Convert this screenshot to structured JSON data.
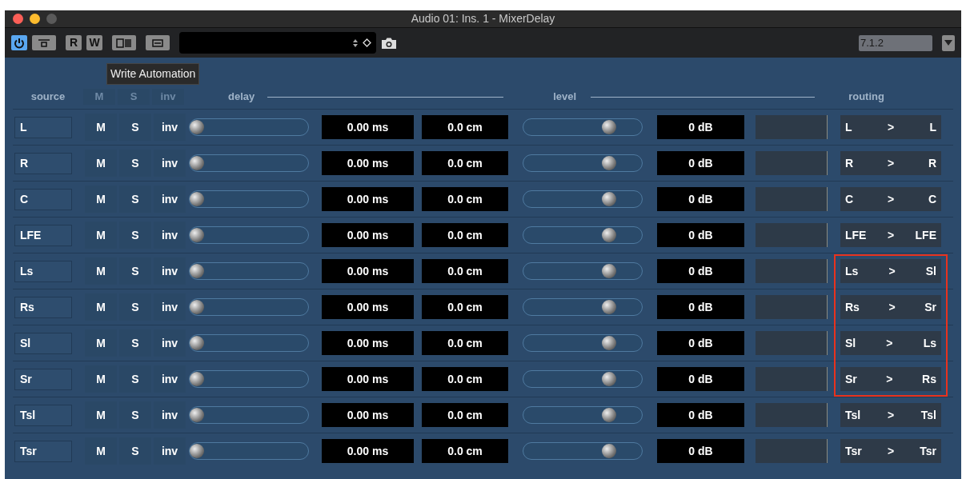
{
  "window": {
    "title": "Audio 01: Ins. 1 - MixerDelay"
  },
  "toolbar": {
    "buttons": [
      {
        "kind": "power",
        "on": true
      },
      {
        "kind": "bypass",
        "on": false
      },
      {
        "kind": "read",
        "label": "R",
        "on": false
      },
      {
        "kind": "write",
        "label": "W",
        "on": false
      },
      {
        "kind": "ab",
        "on": false
      },
      {
        "kind": "panel",
        "on": false
      }
    ],
    "tooltip": "Write Automation",
    "format": "7.1.2"
  },
  "header": {
    "source": "source",
    "mute": "M",
    "solo": "S",
    "invert": "inv",
    "delay": "delay",
    "level": "level",
    "routing": "routing"
  },
  "channels": [
    {
      "source": "L",
      "mute": "M",
      "solo": "S",
      "invert": "inv",
      "delay_slider": {
        "level": 0
      },
      "delay_ms": "0.00 ms",
      "delay_cm": "0.0 cm",
      "gain_slider": {
        "level": 0.75
      },
      "gain": "0 dB",
      "route_in": "L",
      "arrow": ">",
      "route_out": "L",
      "highlighted": false
    },
    {
      "source": "R",
      "mute": "M",
      "solo": "S",
      "invert": "inv",
      "delay_slider": {
        "level": 0
      },
      "delay_ms": "0.00 ms",
      "delay_cm": "0.0 cm",
      "gain_slider": {
        "level": 0.75
      },
      "gain": "0 dB",
      "route_in": "R",
      "arrow": ">",
      "route_out": "R",
      "highlighted": false
    },
    {
      "source": "C",
      "mute": "M",
      "solo": "S",
      "invert": "inv",
      "delay_slider": {
        "level": 0
      },
      "delay_ms": "0.00 ms",
      "delay_cm": "0.0 cm",
      "gain_slider": {
        "level": 0.75
      },
      "gain": "0 dB",
      "route_in": "C",
      "arrow": ">",
      "route_out": "C",
      "highlighted": false
    },
    {
      "source": "LFE",
      "mute": "M",
      "solo": "S",
      "invert": "inv",
      "delay_slider": {
        "level": 0
      },
      "delay_ms": "0.00 ms",
      "delay_cm": "0.0 cm",
      "gain_slider": {
        "level": 0.75
      },
      "gain": "0 dB",
      "route_in": "LFE",
      "arrow": ">",
      "route_out": "LFE",
      "highlighted": false
    },
    {
      "source": "Ls",
      "mute": "M",
      "solo": "S",
      "invert": "inv",
      "delay_slider": {
        "level": 0
      },
      "delay_ms": "0.00 ms",
      "delay_cm": "0.0 cm",
      "gain_slider": {
        "level": 0.75
      },
      "gain": "0 dB",
      "route_in": "Ls",
      "arrow": ">",
      "route_out": "Sl",
      "highlighted": true
    },
    {
      "source": "Rs",
      "mute": "M",
      "solo": "S",
      "invert": "inv",
      "delay_slider": {
        "level": 0
      },
      "delay_ms": "0.00 ms",
      "delay_cm": "0.0 cm",
      "gain_slider": {
        "level": 0.75
      },
      "gain": "0 dB",
      "route_in": "Rs",
      "arrow": ">",
      "route_out": "Sr",
      "highlighted": true
    },
    {
      "source": "Sl",
      "mute": "M",
      "solo": "S",
      "invert": "inv",
      "delay_slider": {
        "level": 0
      },
      "delay_ms": "0.00 ms",
      "delay_cm": "0.0 cm",
      "gain_slider": {
        "level": 0.75
      },
      "gain": "0 dB",
      "route_in": "Sl",
      "arrow": ">",
      "route_out": "Ls",
      "highlighted": true
    },
    {
      "source": "Sr",
      "mute": "M",
      "solo": "S",
      "invert": "inv",
      "delay_slider": {
        "level": 0
      },
      "delay_ms": "0.00 ms",
      "delay_cm": "0.0 cm",
      "gain_slider": {
        "level": 0.75
      },
      "gain": "0 dB",
      "route_in": "Sr",
      "arrow": ">",
      "route_out": "Rs",
      "highlighted": true
    },
    {
      "source": "Tsl",
      "mute": "M",
      "solo": "S",
      "invert": "inv",
      "delay_slider": {
        "level": 0
      },
      "delay_ms": "0.00 ms",
      "delay_cm": "0.0 cm",
      "gain_slider": {
        "level": 0.75
      },
      "gain": "0 dB",
      "route_in": "Tsl",
      "arrow": ">",
      "route_out": "Tsl",
      "highlighted": false
    },
    {
      "source": "Tsr",
      "mute": "M",
      "solo": "S",
      "invert": "inv",
      "delay_slider": {
        "level": 0
      },
      "delay_ms": "0.00 ms",
      "delay_cm": "0.0 cm",
      "gain_slider": {
        "level": 0.75
      },
      "gain": "0 dB",
      "route_in": "Tsr",
      "arrow": ">",
      "route_out": "Tsr",
      "highlighted": false
    }
  ]
}
